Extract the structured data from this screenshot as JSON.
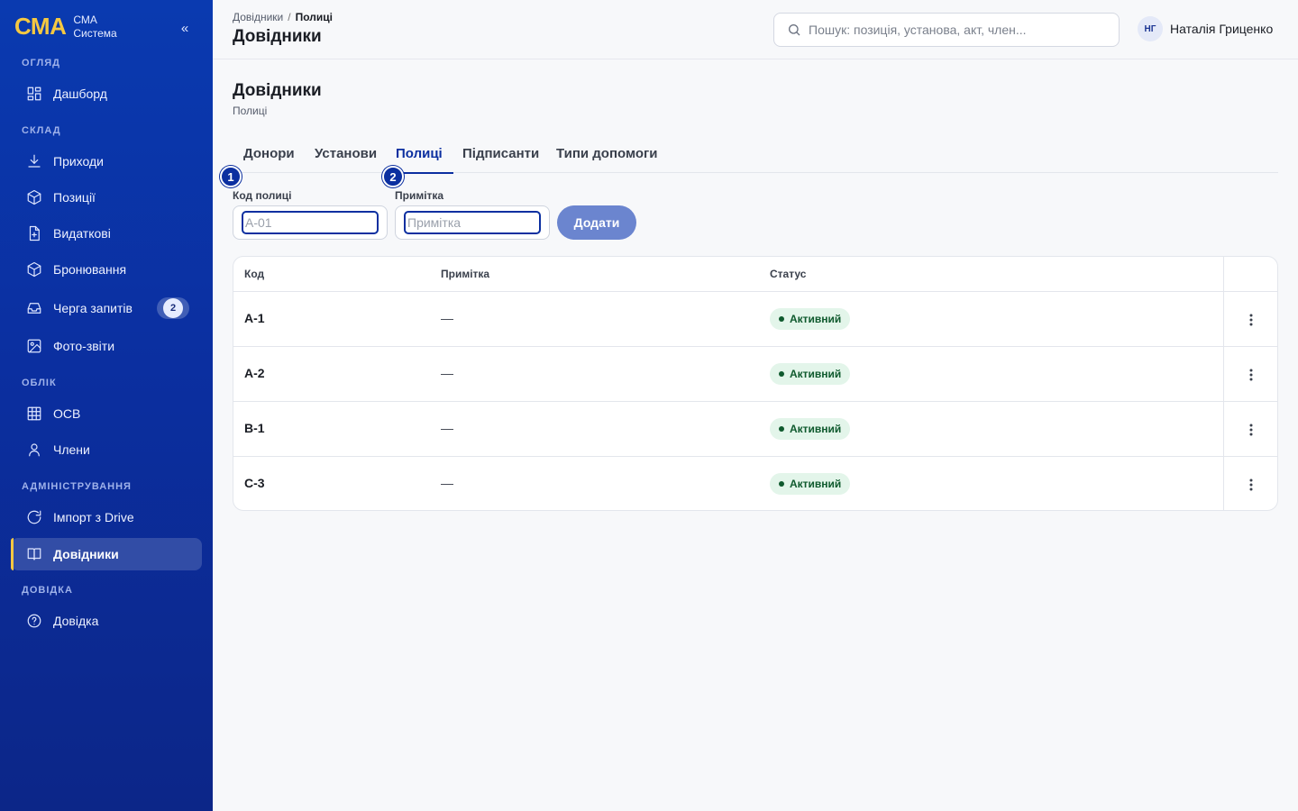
{
  "brand": {
    "logo": "СМА",
    "line1": "СМА",
    "line2": "Система",
    "collapse": "«"
  },
  "sidebar": {
    "sections": [
      "ОГЛЯД",
      "СКЛАД",
      "ОБЛІК",
      "АДМІНІСТРУВАННЯ",
      "ДОВІДКА"
    ],
    "items": [
      {
        "label": "Дашборд",
        "icon": "dashboard-icon"
      },
      {
        "label": "Приходи",
        "icon": "download-icon"
      },
      {
        "label": "Позиції",
        "icon": "box-icon"
      },
      {
        "label": "Видаткові",
        "icon": "file-icon"
      },
      {
        "label": "Бронювання",
        "icon": "box-icon"
      },
      {
        "label": "Черга запитів",
        "icon": "inbox-icon",
        "badge": "2"
      },
      {
        "label": "Фото-звіти",
        "icon": "image-icon"
      },
      {
        "label": "ОСВ",
        "icon": "grid-icon"
      },
      {
        "label": "Члени",
        "icon": "user-icon"
      },
      {
        "label": "Імпорт з Drive",
        "icon": "refresh-icon"
      },
      {
        "label": "Довідники",
        "icon": "book-icon",
        "active": true
      },
      {
        "label": "Довідка",
        "icon": "help-icon"
      }
    ]
  },
  "header": {
    "breadcrumb": [
      "Довідники",
      "Полиці"
    ],
    "breadcrumb_sep": "/",
    "title": "Довідники",
    "search_placeholder": "Пошук: позиція, установа, акт, член...",
    "user_initials": "НГ",
    "user_name": "Наталія Гриценко"
  },
  "page": {
    "title": "Довідники",
    "subtitle": "Полиці",
    "tabs": [
      "Донори",
      "Установи",
      "Полиці",
      "Підписанти",
      "Типи допомоги"
    ],
    "active_tab": "Полиці"
  },
  "form": {
    "markers": [
      "1",
      "2"
    ],
    "code_label": "Код полиці",
    "code_placeholder": "А-01",
    "note_label": "Примітка",
    "note_placeholder": "Примітка",
    "submit": "Додати"
  },
  "table": {
    "columns": [
      "Код",
      "Примітка",
      "Статус"
    ],
    "rows": [
      {
        "code": "А-1",
        "note": "—",
        "status": "Активний"
      },
      {
        "code": "А-2",
        "note": "—",
        "status": "Активний"
      },
      {
        "code": "В-1",
        "note": "—",
        "status": "Активний"
      },
      {
        "code": "С-3",
        "note": "—",
        "status": "Активний"
      }
    ]
  },
  "colors": {
    "sidebar": "#0b2fa0",
    "accent": "#f5c842",
    "primary": "#0b2fa0",
    "button": "#6b85cf",
    "status_bg": "#e3f5ea",
    "status_text": "#0f5a2e"
  }
}
